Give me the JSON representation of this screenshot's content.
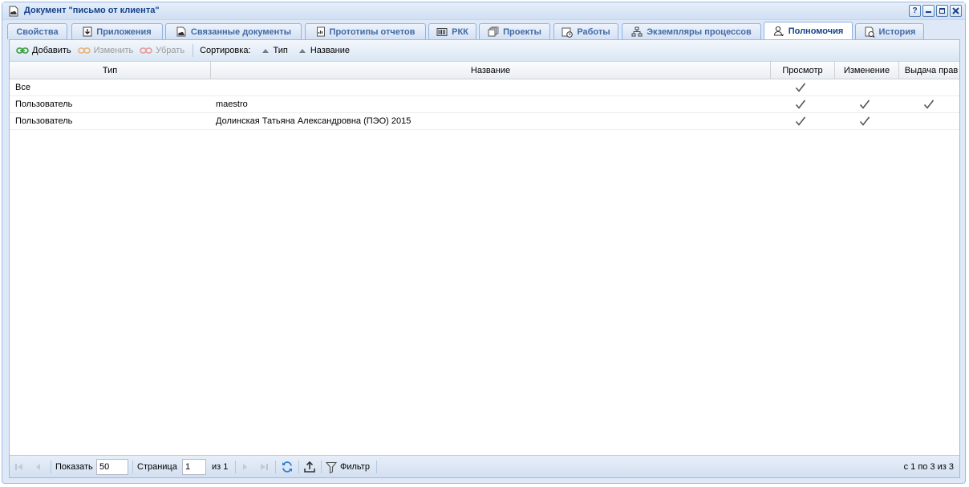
{
  "window": {
    "title": "Документ \"письмо от клиента\"",
    "buttons": [
      "?",
      "minimize",
      "maximize",
      "close"
    ]
  },
  "tabs": [
    {
      "label": "Свойства",
      "icon": "none",
      "active": false
    },
    {
      "label": "Приложения",
      "icon": "download-icon",
      "active": false
    },
    {
      "label": "Связанные документы",
      "icon": "document-cloud-icon",
      "active": false
    },
    {
      "label": "Прототипы отчетов",
      "icon": "report-icon",
      "active": false
    },
    {
      "label": "РКК",
      "icon": "barcode-icon",
      "active": false
    },
    {
      "label": "Проекты",
      "icon": "projects-icon",
      "active": false
    },
    {
      "label": "Работы",
      "icon": "calendar-clock-icon",
      "active": false
    },
    {
      "label": "Экземпляры процессов",
      "icon": "hierarchy-icon",
      "active": false
    },
    {
      "label": "Полномочия",
      "icon": "user-key-icon",
      "active": true
    },
    {
      "label": "История",
      "icon": "history-icon",
      "active": false
    }
  ],
  "toolbar": {
    "add_label": "Добавить",
    "edit_label": "Изменить",
    "remove_label": "Убрать",
    "sort_label": "Сортировка:",
    "sort_type_label": "Тип",
    "sort_name_label": "Название"
  },
  "grid": {
    "columns": [
      "Тип",
      "Название",
      "Просмотр",
      "Изменение",
      "Выдача прав"
    ],
    "rows": [
      {
        "type": "Все",
        "name": "",
        "view": true,
        "edit": false,
        "grant": false
      },
      {
        "type": "Пользователь",
        "name": "maestro",
        "view": true,
        "edit": true,
        "grant": true
      },
      {
        "type": "Пользователь",
        "name": "Долинская Татьяна Александровна (ПЭО) 2015",
        "view": true,
        "edit": true,
        "grant": false
      }
    ]
  },
  "pager": {
    "show_label": "Показать",
    "page_size": "50",
    "page_label": "Страница",
    "page": "1",
    "of_label": "из 1",
    "filter_label": "Фильтр",
    "summary": "с 1 по 3 из 3"
  },
  "colors": {
    "accent": "#15428b",
    "border": "#99bbe8",
    "background": "#dfe8f6"
  }
}
